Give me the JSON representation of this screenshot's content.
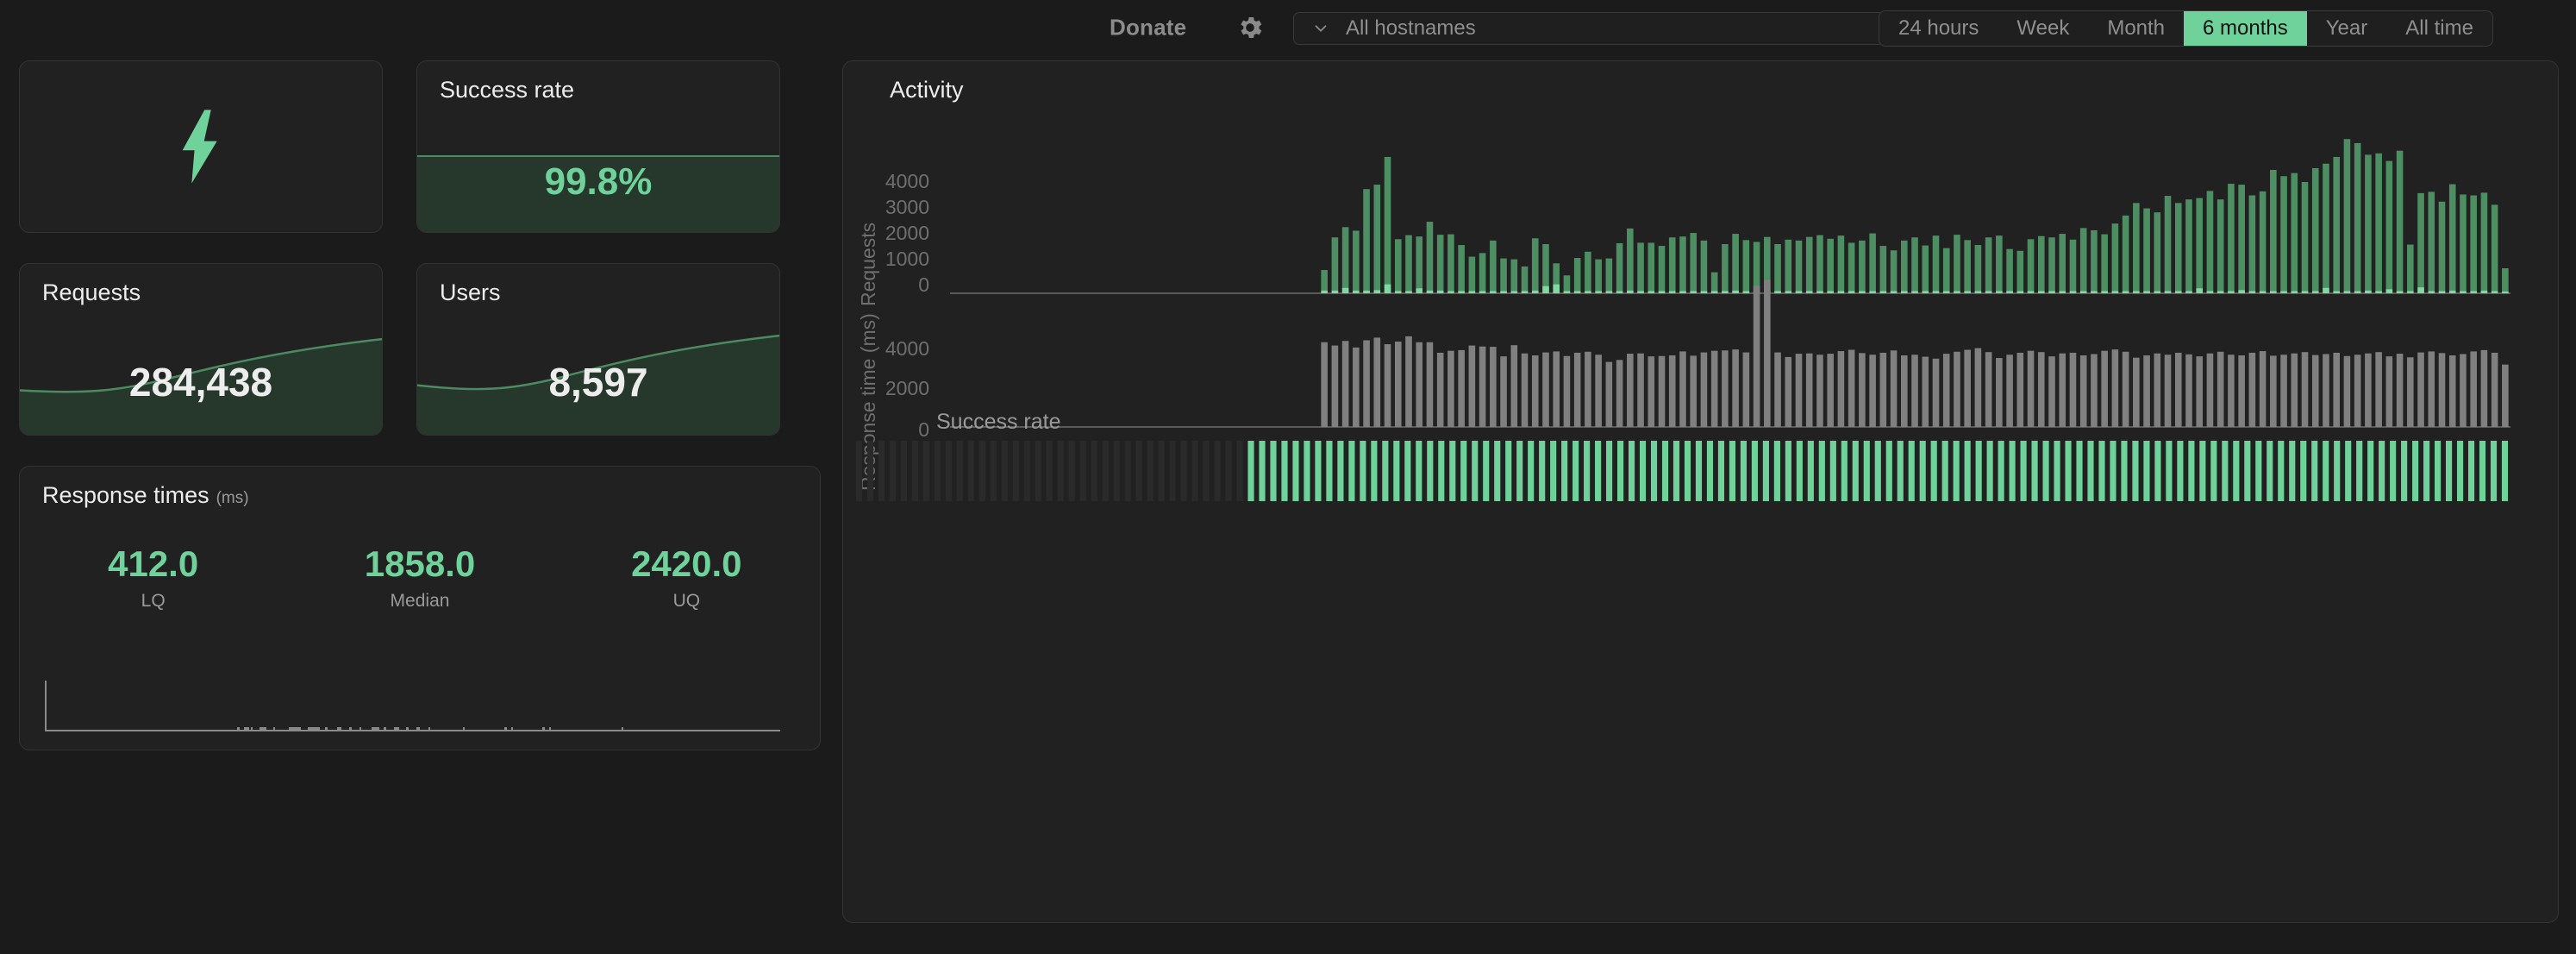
{
  "topbar": {
    "donate_label": "Donate",
    "gear_icon": "gear-icon",
    "hostname": {
      "chevron_icon": "chevron-down-icon",
      "value": "All hostnames"
    },
    "ranges": [
      {
        "label": "24 hours",
        "active": false
      },
      {
        "label": "Week",
        "active": false
      },
      {
        "label": "Month",
        "active": false
      },
      {
        "label": "6 months",
        "active": true
      },
      {
        "label": "Year",
        "active": false
      },
      {
        "label": "All time",
        "active": false
      }
    ]
  },
  "cards": {
    "uptime": {
      "icon": "lightning-bolt-icon"
    },
    "success_rate": {
      "title": "Success rate",
      "value": "99.8%",
      "fill_ratio": 0.45
    },
    "requests": {
      "title": "Requests",
      "value": "284,438"
    },
    "users": {
      "title": "Users",
      "value": "8,597"
    },
    "response_times": {
      "title": "Response times",
      "unit": "(ms)",
      "stats": [
        {
          "value": "412.0",
          "label": "LQ"
        },
        {
          "value": "1858.0",
          "label": "Median"
        },
        {
          "value": "2420.0",
          "label": "UQ"
        }
      ]
    }
  },
  "activity": {
    "title": "Activity",
    "success_rate_label": "Success rate"
  },
  "colors": {
    "accent_green": "#6ed29a",
    "bar_green": "#4d8f63",
    "bar_green_light": "#7fd9a1",
    "bar_gray": "#808080",
    "background": "#1b1b1b",
    "card_background": "#212121",
    "card_border": "#333333",
    "muted_text": "#8f8f8f"
  },
  "chart_data": [
    {
      "type": "bar",
      "name": "requests-chart",
      "title": "Activity",
      "ylabel": "Requests",
      "xlabel": "",
      "ytick_labels": [
        "0",
        "1000",
        "2000",
        "3000",
        "4000"
      ],
      "yticks": [
        0,
        1000,
        2000,
        3000,
        4000
      ],
      "ylim": [
        0,
        4400
      ],
      "grid": false,
      "empty_leading_slots": 35,
      "series": [
        {
          "name": "Requests",
          "color": "#4d8f63",
          "values": [
            520,
            1250,
            1480,
            1400,
            2330,
            2430,
            3050,
            1210,
            1300,
            1270,
            1600,
            1310,
            1320,
            1080,
            820,
            900,
            1180,
            780,
            760,
            600,
            1230,
            1100,
            670,
            400,
            790,
            930,
            760,
            780,
            1120,
            1450,
            1130,
            1130,
            1060,
            1250,
            1270,
            1350,
            1180,
            470,
            1100,
            1330,
            1190,
            1150,
            1260,
            1100,
            1200,
            1180,
            1260,
            1300,
            1220,
            1290,
            1130,
            1180,
            1340,
            1060,
            960,
            1180,
            1250,
            1070,
            1290,
            1010,
            1310,
            1190,
            1080,
            1250,
            1290,
            990,
            950,
            1210,
            1280,
            1250,
            1330,
            1200,
            1460,
            1410,
            1320,
            1560,
            1740,
            2020,
            1900,
            1810,
            2180,
            2020,
            2100,
            2130,
            2290,
            2100,
            2450,
            2430,
            2190,
            2280,
            2760,
            2620,
            2690,
            2490,
            2800,
            2900,
            3050,
            3450,
            3360,
            3100,
            3130,
            2960,
            3190,
            1090,
            2240,
            2270,
            2050,
            2440,
            2210,
            2190,
            2250,
            1980,
            560
          ]
        },
        {
          "name": "Errors/new sessions (base)",
          "color": "#7fd9a1",
          "values": [
            60,
            60,
            120,
            60,
            60,
            70,
            200,
            50,
            50,
            110,
            60,
            60,
            50,
            50,
            50,
            50,
            50,
            50,
            50,
            50,
            60,
            160,
            200,
            50,
            50,
            50,
            50,
            50,
            50,
            60,
            50,
            50,
            50,
            50,
            50,
            50,
            50,
            50,
            50,
            60,
            50,
            50,
            50,
            50,
            50,
            50,
            50,
            50,
            50,
            50,
            50,
            50,
            50,
            50,
            50,
            50,
            50,
            50,
            50,
            50,
            50,
            50,
            50,
            50,
            50,
            50,
            50,
            50,
            50,
            50,
            50,
            50,
            50,
            50,
            50,
            50,
            50,
            50,
            50,
            50,
            50,
            50,
            50,
            110,
            50,
            50,
            50,
            70,
            50,
            50,
            50,
            50,
            50,
            50,
            50,
            120,
            50,
            50,
            50,
            60,
            50,
            90,
            50,
            50,
            130,
            50,
            50,
            60,
            50,
            50,
            60,
            50,
            40
          ]
        }
      ]
    },
    {
      "type": "bar",
      "name": "response-time-chart",
      "title": "",
      "ylabel": "Response time (ms)",
      "xlabel": "",
      "ytick_labels": [
        "0",
        "2000",
        "4000"
      ],
      "yticks": [
        0,
        2000,
        4000
      ],
      "ylim": [
        0,
        5200
      ],
      "grid": false,
      "empty_leading_slots": 35,
      "series": [
        {
          "name": "Response time",
          "color": "#808080",
          "values": [
            2580,
            2480,
            2620,
            2420,
            2640,
            2720,
            2520,
            2600,
            2760,
            2580,
            2580,
            2260,
            2320,
            2340,
            2480,
            2450,
            2440,
            2150,
            2490,
            2240,
            2180,
            2270,
            2300,
            2160,
            2260,
            2290,
            2200,
            1980,
            2040,
            2230,
            2240,
            2150,
            2160,
            2180,
            2300,
            2170,
            2270,
            2320,
            2330,
            2360,
            2270,
            4300,
            4480,
            2270,
            2130,
            2230,
            2240,
            2200,
            2230,
            2310,
            2350,
            2250,
            2200,
            2260,
            2330,
            2180,
            2200,
            2140,
            2080,
            2230,
            2290,
            2350,
            2400,
            2280,
            2100,
            2200,
            2260,
            2320,
            2280,
            2150,
            2240,
            2260,
            2180,
            2220,
            2320,
            2360,
            2290,
            2110,
            2180,
            2240,
            2200,
            2260,
            2210,
            2150,
            2240,
            2290,
            2200,
            2180,
            2260,
            2310,
            2170,
            2200,
            2240,
            2280,
            2190,
            2220,
            2260,
            2160,
            2200,
            2240,
            2280,
            2150,
            2230,
            2120,
            2270,
            2300,
            2250,
            2180,
            2220,
            2300,
            2340,
            2260,
            1900
          ]
        }
      ]
    },
    {
      "type": "bar",
      "name": "success-rate-strip",
      "title": "Success rate",
      "ylabel": "",
      "xlabel": "",
      "ylim": [
        0,
        100
      ],
      "grid": false,
      "empty_leading_slots": 35,
      "empty_color": "#2a2a2a",
      "series": [
        {
          "name": "Success rate %",
          "color": "#6ed29a",
          "values": [
            100,
            100,
            100,
            100,
            100,
            100,
            100,
            100,
            100,
            100,
            100,
            100,
            100,
            100,
            100,
            100,
            100,
            100,
            100,
            100,
            100,
            100,
            100,
            100,
            100,
            100,
            100,
            100,
            100,
            100,
            100,
            100,
            100,
            100,
            100,
            100,
            100,
            100,
            100,
            100,
            100,
            100,
            100,
            100,
            100,
            100,
            100,
            100,
            100,
            100,
            100,
            100,
            100,
            100,
            100,
            100,
            100,
            100,
            100,
            100,
            100,
            100,
            100,
            100,
            100,
            100,
            100,
            100,
            100,
            100,
            100,
            100,
            100,
            100,
            100,
            100,
            100,
            100,
            100,
            100,
            100,
            100,
            100,
            100,
            100,
            100,
            100,
            100,
            100,
            100,
            100,
            100,
            100,
            100,
            100,
            100,
            100,
            100,
            100,
            100,
            100,
            100,
            100,
            100,
            100,
            100,
            100,
            100,
            100,
            100,
            100,
            100,
            100
          ]
        }
      ]
    },
    {
      "type": "area",
      "name": "requests-sparkline",
      "title": "Requests",
      "ylim": [
        0,
        1
      ],
      "grid": false,
      "values": [
        0.22,
        0.21,
        0.2,
        0.2,
        0.21,
        0.23,
        0.27,
        0.33,
        0.42,
        0.5,
        0.56,
        0.6
      ]
    },
    {
      "type": "area",
      "name": "users-sparkline",
      "title": "Users",
      "ylim": [
        0,
        1
      ],
      "grid": false,
      "values": [
        0.25,
        0.23,
        0.22,
        0.22,
        0.24,
        0.27,
        0.32,
        0.38,
        0.46,
        0.53,
        0.58,
        0.62
      ]
    }
  ]
}
